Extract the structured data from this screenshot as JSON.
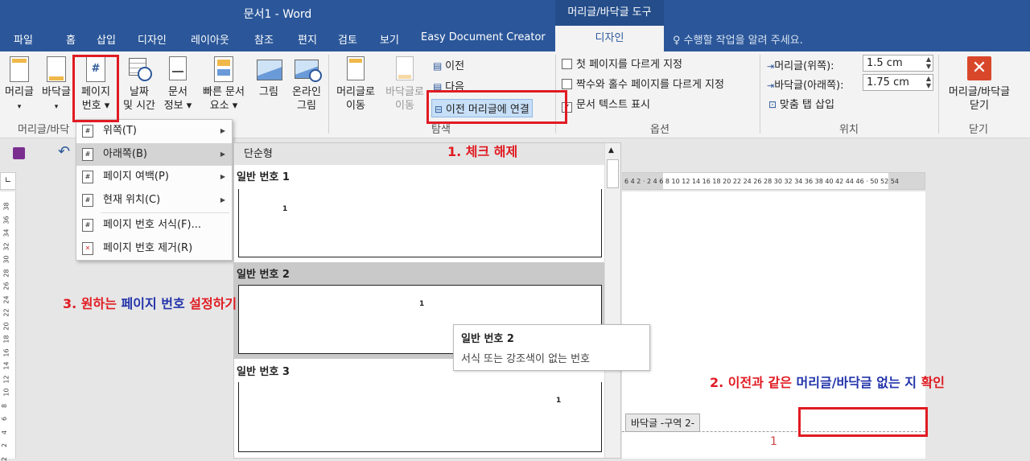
{
  "window": {
    "title": "문서1 - Word",
    "context_group": "머리글/바닥글 도구"
  },
  "tabs": [
    "파일",
    "홈",
    "삽입",
    "디자인",
    "레이아웃",
    "참조",
    "편지",
    "검토",
    "보기",
    "Easy Document Creator"
  ],
  "active_tab": "디자인",
  "tell_me": "수행할 작업을 알려 주세요.",
  "ribbon": {
    "hf_group": {
      "header": "머리글",
      "footer": "바닥글",
      "page_number_1": "페이지",
      "page_number_2": "번호 ▾",
      "label": "머리글/바닥"
    },
    "insert_group": {
      "date_1": "날짜",
      "date_2": "및 시간",
      "docinfo_1": "문서",
      "docinfo_2": "정보 ▾",
      "quick_1": "빠른 문서",
      "quick_2": "요소 ▾",
      "picture": "그림",
      "online_1": "온라인",
      "online_2": "그림"
    },
    "nav_group": {
      "goto_header_1": "머리글로",
      "goto_header_2": "이동",
      "goto_footer_1": "바닥글로",
      "goto_footer_2": "이동",
      "previous": "이전",
      "next": "다음",
      "link_previous": "이전 머리글에 연결",
      "label": "탐색"
    },
    "options_group": {
      "first_page": "첫 페이지를 다르게 지정",
      "odd_even": "짝수와 홀수 페이지를 다르게 지정",
      "show_text": "문서 텍스트 표시",
      "label": "옵션"
    },
    "position_group": {
      "header_top": "머리글(위쪽):",
      "header_top_val": "1.5 cm",
      "footer_bottom": "바닥글(아래쪽):",
      "footer_bottom_val": "1.75 cm",
      "align_tab": "맞춤 탭 삽입",
      "label": "위치"
    },
    "close_group": {
      "close_1": "머리글/바닥글",
      "close_2": "닫기",
      "label": "닫기",
      "accent": "#d9472b"
    }
  },
  "page_number_menu": [
    {
      "label": "위쪽(T)",
      "submenu": true
    },
    {
      "label": "아래쪽(B)",
      "submenu": true
    },
    {
      "label": "페이지 여백(P)",
      "submenu": true
    },
    {
      "label": "현재 위치(C)",
      "submenu": true
    },
    {
      "label": "페이지 번호 서식(F)...",
      "submenu": false
    },
    {
      "label": "페이지 번호 제거(R)",
      "submenu": false
    }
  ],
  "gallery": {
    "section": "단순형",
    "items": [
      {
        "title": "일반 번호 1",
        "mark": "1"
      },
      {
        "title": "일반 번호 2",
        "mark": "1"
      },
      {
        "title": "일반 번호 3",
        "mark": "1"
      }
    ]
  },
  "tooltip": {
    "title": "일반 번호 2",
    "desc": "서식 또는 강조색이 없는 번호"
  },
  "ruler_top": "6 4 2 · 2 4 6 8 10 12 14 16 18 20 22 24 26 28 30 32 34 36 38 40 42 44 46 · 50 52 54",
  "ruler_left": [
    "38",
    "36",
    "34",
    "32",
    "30",
    "28",
    "26",
    "24",
    "22",
    "20",
    "18",
    "16",
    "14",
    "12",
    "10",
    "8",
    "6",
    "4",
    "2",
    "2"
  ],
  "document": {
    "footer_tag": "바닥글 -구역 2-",
    "page_num": "1"
  },
  "annotations": {
    "step1": "1. 체크 해제",
    "step2_a": "2. 이전과 같은 ",
    "step2_b": "머리글/바닥글 없는 지",
    "step2_c": " 확인",
    "step3_a": "3. 원하는 ",
    "step3_b": "페이지 번호",
    "step3_c": " 설정하기"
  },
  "colors": {
    "word_blue": "#2b579a",
    "annot_red": "#e01b22",
    "annot_blue": "#2233aa"
  }
}
